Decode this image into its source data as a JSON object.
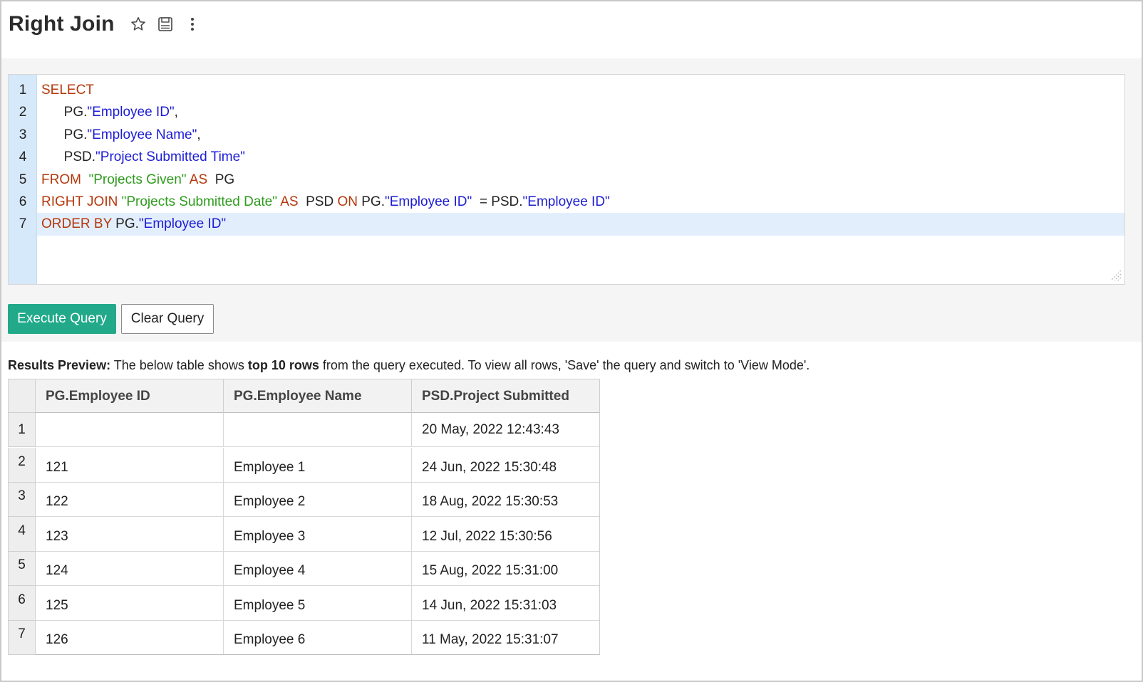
{
  "header": {
    "title": "Right Join",
    "icons": [
      "star-icon",
      "save-icon",
      "more-vertical-icon"
    ]
  },
  "editor": {
    "lines": [
      [
        {
          "t": "kw",
          "v": "SELECT"
        }
      ],
      [
        {
          "t": "plain",
          "v": "      PG."
        },
        {
          "t": "id",
          "v": "\"Employee ID\""
        },
        {
          "t": "plain",
          "v": ","
        }
      ],
      [
        {
          "t": "plain",
          "v": "      PG."
        },
        {
          "t": "id",
          "v": "\"Employee Name\""
        },
        {
          "t": "plain",
          "v": ","
        }
      ],
      [
        {
          "t": "plain",
          "v": "      PSD."
        },
        {
          "t": "id",
          "v": "\"Project Submitted Time\""
        }
      ],
      [
        {
          "t": "kw",
          "v": "FROM"
        },
        {
          "t": "plain",
          "v": "  "
        },
        {
          "t": "str",
          "v": "\"Projects Given\""
        },
        {
          "t": "plain",
          "v": " "
        },
        {
          "t": "kw",
          "v": "AS"
        },
        {
          "t": "plain",
          "v": "  PG"
        }
      ],
      [
        {
          "t": "kw",
          "v": "RIGHT JOIN"
        },
        {
          "t": "plain",
          "v": " "
        },
        {
          "t": "str",
          "v": "\"Projects Submitted Date\""
        },
        {
          "t": "plain",
          "v": " "
        },
        {
          "t": "kw",
          "v": "AS"
        },
        {
          "t": "plain",
          "v": "  PSD "
        },
        {
          "t": "kw",
          "v": "ON"
        },
        {
          "t": "plain",
          "v": " PG."
        },
        {
          "t": "id",
          "v": "\"Employee ID\""
        },
        {
          "t": "plain",
          "v": "  = PSD."
        },
        {
          "t": "id",
          "v": "\"Employee ID\""
        }
      ],
      [
        {
          "t": "kw",
          "v": "ORDER BY"
        },
        {
          "t": "plain",
          "v": " PG."
        },
        {
          "t": "id",
          "v": "\"Employee ID\""
        }
      ]
    ],
    "line_numbers": [
      "1",
      "2",
      "3",
      "4",
      "5",
      "6",
      "7"
    ],
    "active_line": 7
  },
  "buttons": {
    "execute_label": "Execute Query",
    "clear_label": "Clear Query"
  },
  "preview": {
    "label": "Results Preview:",
    "text_a": " The below table shows ",
    "bold": "top 10 rows",
    "text_b": " from the query executed. To view all rows, 'Save' the query and switch to 'View Mode'."
  },
  "table": {
    "columns": [
      "PG.Employee ID",
      "PG.Employee Name",
      "PSD.Project Submitted Time"
    ],
    "rows": [
      {
        "n": "1",
        "cells": [
          "",
          "",
          "20 May, 2022 12:43:43"
        ]
      },
      {
        "n": "2",
        "cells": [
          "121",
          "Employee 1",
          "24 Jun, 2022 15:30:48"
        ]
      },
      {
        "n": "3",
        "cells": [
          "122",
          "Employee 2",
          "18 Aug, 2022 15:30:53"
        ]
      },
      {
        "n": "4",
        "cells": [
          "123",
          "Employee 3",
          "12 Jul, 2022 15:30:56"
        ]
      },
      {
        "n": "5",
        "cells": [
          "124",
          "Employee 4",
          "15 Aug, 2022 15:31:00"
        ]
      },
      {
        "n": "6",
        "cells": [
          "125",
          "Employee 5",
          "14 Jun, 2022 15:31:03"
        ]
      },
      {
        "n": "7",
        "cells": [
          "126",
          "Employee 6",
          "11 May, 2022 15:31:07"
        ]
      }
    ]
  },
  "colors": {
    "accent": "#21a98a",
    "keyword": "#b5370b",
    "string": "#2d9b1c",
    "identifier": "#1c1cd6",
    "gutter": "#d6e9fb"
  }
}
